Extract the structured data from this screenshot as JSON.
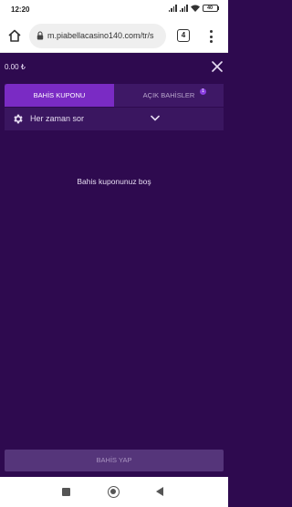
{
  "status_bar": {
    "time": "12:20",
    "battery": "40",
    "icons": [
      "signal-icon",
      "signal-icon",
      "wifi-icon",
      "battery-icon"
    ]
  },
  "browser": {
    "url": "m.piabellacasino140.com/tr/s",
    "tab_count": "4",
    "icons": [
      "home-icon",
      "lock-icon",
      "tabs-icon",
      "menu-icon"
    ]
  },
  "betslip": {
    "balance": "0.00 ₺",
    "tabs": [
      {
        "label": "BAHİS KUPONU",
        "active": true
      },
      {
        "label": "AÇIK BAHİSLER",
        "badge": "1",
        "active": false
      }
    ],
    "setting_label": "Her zaman sor",
    "empty_message": "Bahis kuponunuz boş",
    "place_bet_label": "BAHİS YAP"
  },
  "colors": {
    "background": "#2e0a4f",
    "tab_active": "#7a2bc4",
    "tab_row": "#3e1866",
    "button_disabled": "#55357a"
  }
}
